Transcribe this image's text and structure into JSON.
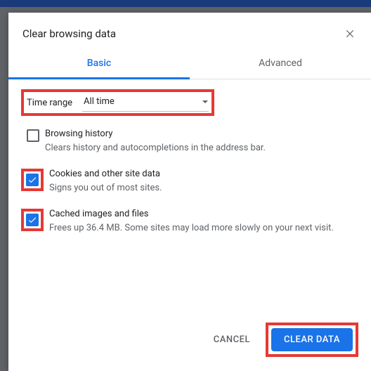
{
  "dialog": {
    "title": "Clear browsing data",
    "tabs": {
      "basic": "Basic",
      "advanced": "Advanced"
    },
    "timerange": {
      "label": "Time range",
      "value": "All time"
    },
    "options": [
      {
        "title": "Browsing history",
        "desc": "Clears history and autocompletions in the address bar."
      },
      {
        "title": "Cookies and other site data",
        "desc": "Signs you out of most sites."
      },
      {
        "title": "Cached images and files",
        "desc": "Frees up 36.4 MB. Some sites may load more slowly on your next visit."
      }
    ],
    "buttons": {
      "cancel": "CANCEL",
      "confirm": "CLEAR DATA"
    }
  }
}
